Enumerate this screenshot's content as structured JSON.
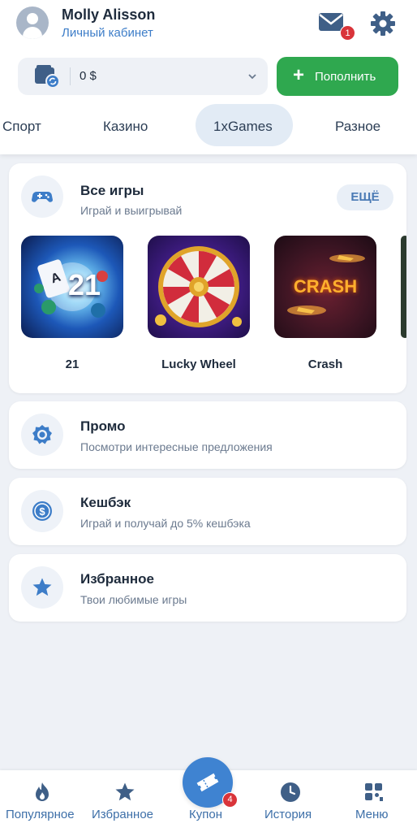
{
  "user": {
    "name": "Molly Alisson",
    "subtitle": "Личный кабинет"
  },
  "notifications": {
    "mail_count": "1"
  },
  "balance": {
    "value": "0 $"
  },
  "topup": {
    "label": "Пополнить"
  },
  "tabs": [
    {
      "label": "Спорт"
    },
    {
      "label": "Казино"
    },
    {
      "label": "1xGames",
      "active": true
    },
    {
      "label": "Разное"
    }
  ],
  "all_games": {
    "title": "Все игры",
    "subtitle": "Играй и выигрывай",
    "more_label": "ЕЩЁ",
    "games": [
      {
        "name": "21",
        "tile_text": "21"
      },
      {
        "name": "Lucky Wheel"
      },
      {
        "name": "Crash",
        "tile_text": "CRASH"
      }
    ]
  },
  "promo": {
    "title": "Промо",
    "subtitle": "Посмотри интересные предложения"
  },
  "cashback": {
    "title": "Кешбэк",
    "subtitle": "Играй и получай до 5% кешбэка"
  },
  "favorites": {
    "title": "Избранное",
    "subtitle": "Твои любимые игры"
  },
  "bottom_nav": {
    "items": [
      {
        "label": "Популярное",
        "icon": "flame-icon"
      },
      {
        "label": "Избранное",
        "icon": "star-icon"
      },
      {
        "label": "Купон",
        "icon": "ticket-icon",
        "badge": "4"
      },
      {
        "label": "История",
        "icon": "clock-icon"
      },
      {
        "label": "Меню",
        "icon": "grid-icon"
      }
    ]
  },
  "colors": {
    "accent": "#3d7dc8",
    "green": "#2fa84f",
    "badge": "#d9343a",
    "background": "#eef1f6"
  }
}
